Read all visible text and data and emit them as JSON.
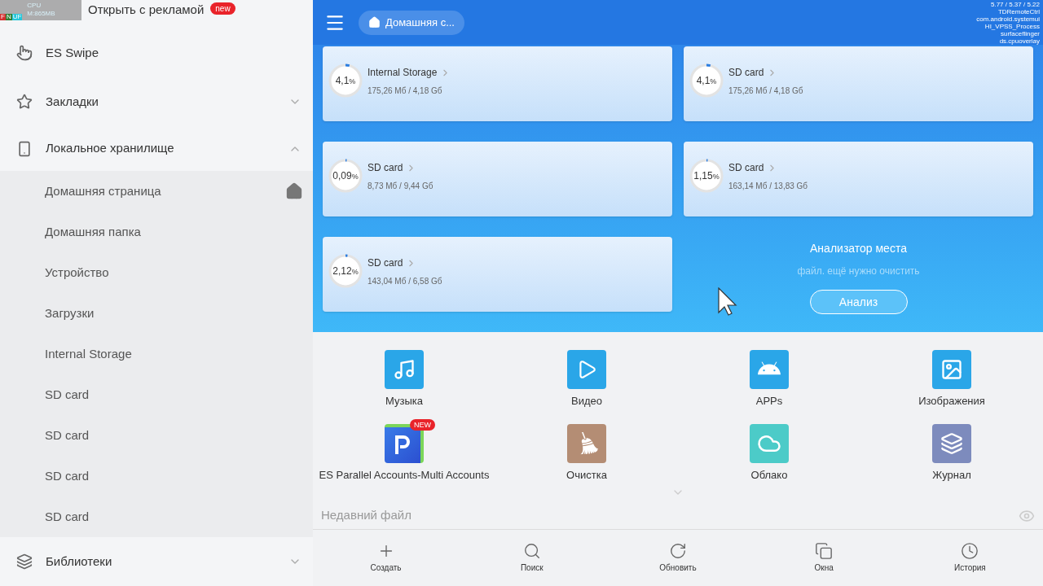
{
  "perf_overlay": {
    "cpu": "CPU",
    "memory": "M:865MB",
    "flags": [
      "F",
      "N",
      "UF"
    ]
  },
  "debug_overlay": [
    "5.77 / 5.37 / 5.22",
    "TDRemoteCtrl",
    "com.android.systemui",
    "HI_VPSS_Process",
    "surfaceflinger",
    "ds.cpuoverlay"
  ],
  "sidebar": {
    "promo": {
      "label": "Открыть с рекламой",
      "badge": "new"
    },
    "items": [
      {
        "kind": "swipe",
        "label": "ES Swipe"
      },
      {
        "kind": "bookmarks",
        "label": "Закладки",
        "expanded": false
      },
      {
        "kind": "local",
        "label": "Локальное хранилище",
        "expanded": true,
        "children": [
          {
            "label": "Домашняя страница",
            "home": true
          },
          {
            "label": "Домашняя папка",
            "home": false
          },
          {
            "label": "Устройство",
            "home": false
          },
          {
            "label": "Загрузки",
            "home": false
          },
          {
            "label": "Internal Storage",
            "home": false
          },
          {
            "label": "SD card",
            "home": false
          },
          {
            "label": "SD card",
            "home": false
          },
          {
            "label": "SD card",
            "home": false
          },
          {
            "label": "SD card",
            "home": false
          }
        ]
      },
      {
        "kind": "libraries",
        "label": "Библиотеки",
        "expanded": false
      }
    ]
  },
  "header": {
    "breadcrumb": "Домашняя с..."
  },
  "storage": [
    {
      "name": "Internal Storage",
      "usage": "175,26 Мб / 4,18 Gб",
      "percent": "4,1",
      "unit": "%",
      "level": 0.041
    },
    {
      "name": "SD card",
      "usage": "175,26 Мб / 4,18 Gб",
      "percent": "4,1",
      "unit": "%",
      "level": 0.041
    },
    {
      "name": "SD card",
      "usage": "8,73 Мб / 9,44 Gб",
      "percent": "0,09",
      "unit": "%",
      "level": 0.0009
    },
    {
      "name": "SD card",
      "usage": "163,14 Мб / 13,83 Gб",
      "percent": "1,15",
      "unit": "%",
      "level": 0.0115
    },
    {
      "name": "SD card",
      "usage": "143,04 Мб / 6,58 Gб",
      "percent": "2,12",
      "unit": "%",
      "level": 0.0212
    }
  ],
  "analyzer": {
    "title": "Анализатор места",
    "subtitle": "файл. ещё нужно очистить",
    "button": "Анализ"
  },
  "shortcuts": [
    {
      "kind": "music",
      "label": "Музыка"
    },
    {
      "kind": "video",
      "label": "Видео"
    },
    {
      "kind": "apps",
      "label": "APPs"
    },
    {
      "kind": "images",
      "label": "Изображения"
    },
    {
      "kind": "parallel",
      "label": "ES Parallel Accounts-Multi Accounts",
      "badge": "NEW"
    },
    {
      "kind": "cleaner",
      "label": "Очистка"
    },
    {
      "kind": "cloud",
      "label": "Облако"
    },
    {
      "kind": "journal",
      "label": "Журнал"
    }
  ],
  "recent": {
    "label": "Недавний файл"
  },
  "toolbar": [
    {
      "kind": "create",
      "label": "Создать"
    },
    {
      "kind": "search",
      "label": "Поиск"
    },
    {
      "kind": "refresh",
      "label": "Обновить"
    },
    {
      "kind": "windows",
      "label": "Окна"
    },
    {
      "kind": "history",
      "label": "История"
    }
  ]
}
